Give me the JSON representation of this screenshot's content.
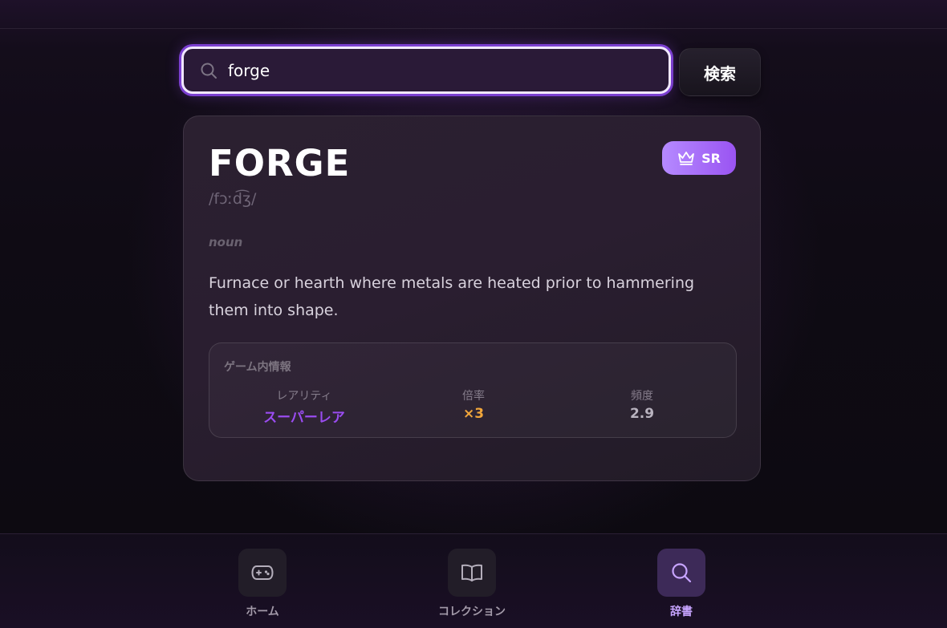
{
  "search": {
    "value": "forge",
    "button_label": "検索"
  },
  "entry": {
    "word": "FORGE",
    "phonetic": "/fɔːd͡ʒ/",
    "rarity_badge": "SR",
    "part_of_speech": "noun",
    "definition": "Furnace or hearth where metals are heated prior to hammering them into shape."
  },
  "game_info": {
    "title": "ゲーム内情報",
    "stats": [
      {
        "label": "レアリティ",
        "value": "スーパーレア",
        "color": "#9a4cf0"
      },
      {
        "label": "倍率",
        "value": "×3",
        "color": "#f1a63b"
      },
      {
        "label": "頻度",
        "value": "2.9",
        "color": "#b9b3bf"
      }
    ]
  },
  "nav": {
    "items": [
      {
        "label": "ホーム",
        "icon": "gamepad-icon"
      },
      {
        "label": "コレクション",
        "icon": "book-icon"
      },
      {
        "label": "辞書",
        "icon": "search-icon"
      }
    ],
    "active": "辞書"
  },
  "colors": {
    "accent": "#9a54f2",
    "badge_gradient_start": "#b58aff"
  }
}
